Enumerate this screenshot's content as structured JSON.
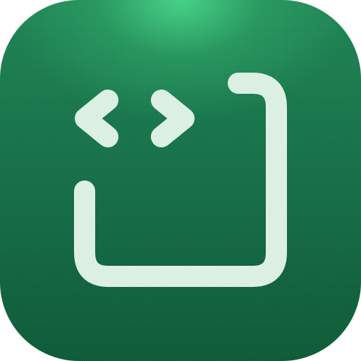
{
  "icon": {
    "description_name": "code-frame-app-icon",
    "colors": {
      "background_top": "#48d68a",
      "background_mid": "#177149",
      "background_bottom": "#0f5b39",
      "glyph": "#dcefe3"
    },
    "glyphs": [
      "chevron-left-icon",
      "chevron-right-icon",
      "frame-corner-icon"
    ]
  }
}
